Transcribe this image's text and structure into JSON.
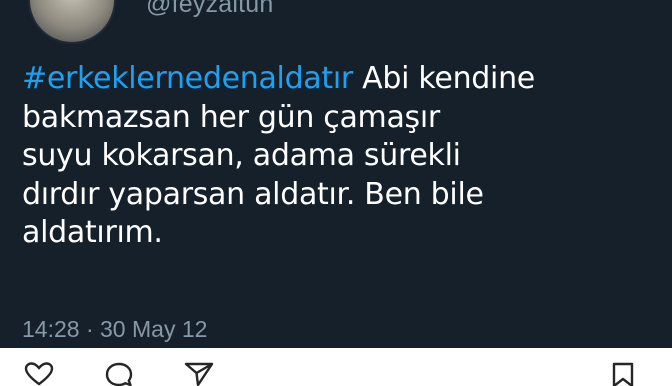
{
  "tweet": {
    "handle": "@feyzaltun",
    "hashtag": "#erkeklernedenaldatır",
    "lines": [
      " Abi kendine",
      "bakmazsan her gün çamaşır",
      "suyu kokarsan, adama sürekli",
      "dırdır yaparsan aldatır. Ben bile",
      "aldatırım."
    ],
    "time": "14:28",
    "separator": "·",
    "date": "30 May 12"
  },
  "actions": {
    "icons": [
      "heart-icon",
      "comment-icon",
      "share-icon",
      "bookmark-icon"
    ]
  },
  "colors": {
    "background": "#15202b",
    "text": "#ffffff",
    "hashtag": "#1da1f2",
    "muted": "#8899a6"
  }
}
